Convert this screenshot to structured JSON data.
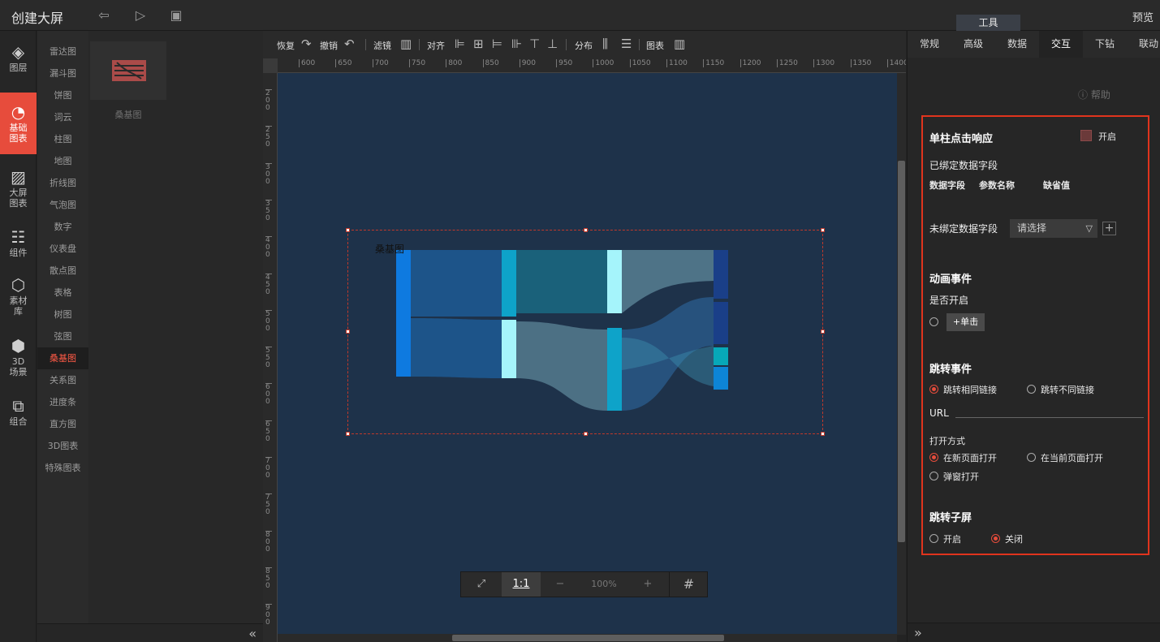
{
  "topbar": {
    "title": "创建大屏",
    "preview": "预览",
    "tool_tab": "工具"
  },
  "leftnav": [
    {
      "label": "图层",
      "icon": "layers-icon"
    },
    {
      "label": "基础\n图表",
      "icon": "pie-chart-icon",
      "active": true
    },
    {
      "label": "大屏\n图表",
      "icon": "presentation-chart-icon"
    },
    {
      "label": "组件",
      "icon": "sliders-icon"
    },
    {
      "label": "素材\n库",
      "icon": "hexagons-icon"
    },
    {
      "label": "3D\n场景",
      "icon": "cube-icon"
    },
    {
      "label": "组合",
      "icon": "combine-icon"
    }
  ],
  "chart_types": [
    "雷达图",
    "漏斗图",
    "饼图",
    "词云",
    "柱图",
    "地图",
    "折线图",
    "气泡图",
    "数字",
    "仪表盘",
    "散点图",
    "表格",
    "树图",
    "弦图",
    "桑基图",
    "关系图",
    "进度条",
    "直方图",
    "3D图表",
    "特殊图表"
  ],
  "active_chart_type": "桑基图",
  "thumb_label": "桑基图",
  "toolbar": {
    "redo": "恢复",
    "undo": "撤销",
    "filter": "滤镜",
    "align": "对齐",
    "distribute": "分布",
    "chart": "图表"
  },
  "ruler_h": [
    "600",
    "650",
    "700",
    "750",
    "800",
    "850",
    "900",
    "950",
    "1000",
    "1050",
    "1100",
    "1150",
    "1200",
    "1250",
    "1300",
    "1350",
    "1400"
  ],
  "ruler_v": [
    "200",
    "250",
    "300",
    "350",
    "400",
    "450",
    "500",
    "550",
    "600",
    "650",
    "700",
    "750",
    "800",
    "850",
    "900"
  ],
  "canvas": {
    "chart_title": "桑基图",
    "bg_color": "#1e324a",
    "selection_color": "#c0392b"
  },
  "zoombar": {
    "fit": "⤢",
    "one_to_one": "1:1",
    "minus": "−",
    "zoom": "100%",
    "plus": "+",
    "grid": "#"
  },
  "rightpanel": {
    "tabs": [
      "常规",
      "高级",
      "数据",
      "交互",
      "下钻",
      "联动"
    ],
    "active_tab": "交互",
    "help": "帮助",
    "single_click": {
      "title": "单柱点击响应",
      "toggle_label": "开启"
    },
    "bound_fields": {
      "title": "已绑定数据字段",
      "col1": "数据字段",
      "col2": "参数名称",
      "col3": "缺省值"
    },
    "unbound_fields": {
      "title": "未绑定数据字段",
      "placeholder": "请选择"
    },
    "animation": {
      "title": "动画事件",
      "enable_label": "是否开启",
      "click_button": "+单击"
    },
    "jump": {
      "title": "跳转事件",
      "same_link": "跳转相同链接",
      "diff_link": "跳转不同链接",
      "url_label": "URL",
      "open_mode_label": "打开方式",
      "new_page": "在新页面打开",
      "current_page": "在当前页面打开",
      "popup": "弹窗打开"
    },
    "sub_screen": {
      "title": "跳转子屏",
      "on": "开启",
      "off": "关闭"
    }
  },
  "accent_color": "#e74c3c"
}
